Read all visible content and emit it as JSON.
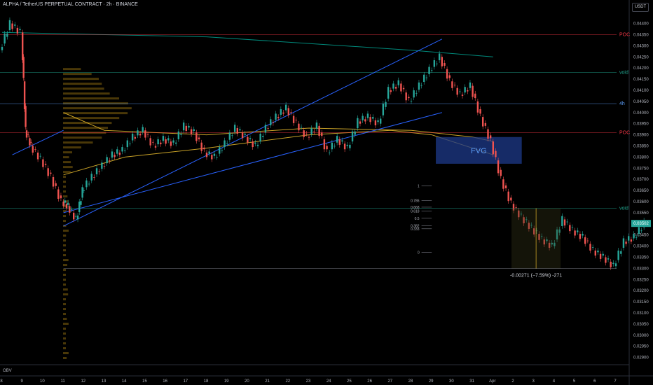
{
  "header": {
    "symbol_title": "ALPHA / TetherUS PERPETUAL CONTRACT · 2h · BINANCE",
    "currency": "USDT"
  },
  "indicator_label": "OBV",
  "chart_data": {
    "type": "candlestick",
    "title": "ALPHA / TetherUS PERPETUAL CONTRACT · 2h · BINANCE",
    "y_ticks": [
      "0.04400",
      "0.04350",
      "0.04300",
      "0.04250",
      "0.04200",
      "0.04150",
      "0.04100",
      "0.04050",
      "0.04000",
      "0.03950",
      "0.03900",
      "0.03850",
      "0.03800",
      "0.03750",
      "0.03700",
      "0.03650",
      "0.03600",
      "0.03550",
      "0.03500",
      "0.03450",
      "0.03400",
      "0.03350",
      "0.03300",
      "0.03250",
      "0.03200",
      "0.03150",
      "0.03100",
      "0.03050",
      "0.03000",
      "0.02950",
      "0.02900"
    ],
    "ylim": [
      0.0288,
      0.0443
    ],
    "x_ticks": [
      "8",
      "9",
      "10",
      "11",
      "12",
      "13",
      "14",
      "15",
      "16",
      "17",
      "18",
      "19",
      "20",
      "21",
      "22",
      "23",
      "24",
      "25",
      "26",
      "27",
      "28",
      "29",
      "30",
      "31",
      "Apr",
      "2",
      "3",
      "4",
      "5",
      "6",
      "7"
    ],
    "current_price": "0.03502",
    "close_path": [
      [
        0,
        0.0428
      ],
      [
        0.5,
        0.044
      ],
      [
        1,
        0.0436
      ],
      [
        1.2,
        0.0392
      ],
      [
        1.5,
        0.0385
      ],
      [
        2,
        0.0379
      ],
      [
        2.5,
        0.0371
      ],
      [
        3,
        0.036
      ],
      [
        3.3,
        0.0358
      ],
      [
        3.7,
        0.0352
      ],
      [
        4,
        0.0365
      ],
      [
        4.5,
        0.0371
      ],
      [
        5,
        0.0376
      ],
      [
        5.5,
        0.0381
      ],
      [
        6,
        0.0383
      ],
      [
        6.5,
        0.0389
      ],
      [
        7,
        0.0392
      ],
      [
        7.5,
        0.0385
      ],
      [
        8,
        0.0388
      ],
      [
        8.5,
        0.0386
      ],
      [
        9,
        0.0394
      ],
      [
        9.5,
        0.0391
      ],
      [
        10,
        0.0382
      ],
      [
        10.5,
        0.038
      ],
      [
        11,
        0.0386
      ],
      [
        11.5,
        0.0393
      ],
      [
        12,
        0.0389
      ],
      [
        12.5,
        0.0385
      ],
      [
        13,
        0.0393
      ],
      [
        13.5,
        0.0398
      ],
      [
        14,
        0.0402
      ],
      [
        14.5,
        0.0395
      ],
      [
        15,
        0.0389
      ],
      [
        15.5,
        0.0394
      ],
      [
        16,
        0.0382
      ],
      [
        16.5,
        0.0388
      ],
      [
        17,
        0.0384
      ],
      [
        17.5,
        0.0396
      ],
      [
        18,
        0.0398
      ],
      [
        18.5,
        0.0395
      ],
      [
        19,
        0.041
      ],
      [
        19.5,
        0.0413
      ],
      [
        20,
        0.0405
      ],
      [
        20.5,
        0.0412
      ],
      [
        21,
        0.0419
      ],
      [
        21.5,
        0.0425
      ],
      [
        22,
        0.0414
      ],
      [
        22.5,
        0.0408
      ],
      [
        23,
        0.0412
      ],
      [
        23.5,
        0.0398
      ],
      [
        24,
        0.0387
      ],
      [
        24.5,
        0.037
      ],
      [
        25,
        0.0359
      ],
      [
        25.5,
        0.0353
      ],
      [
        26,
        0.0348
      ],
      [
        26.5,
        0.0343
      ],
      [
        27,
        0.034
      ],
      [
        27.5,
        0.0352
      ],
      [
        28,
        0.0347
      ],
      [
        28.5,
        0.0344
      ],
      [
        29,
        0.0338
      ],
      [
        29.5,
        0.0335
      ],
      [
        30,
        0.0331
      ],
      [
        30.5,
        0.0342
      ],
      [
        31,
        0.0344
      ],
      [
        31.5,
        0.035
      ]
    ],
    "horizontal_levels": [
      {
        "label": "POC",
        "value": 0.0435,
        "color": "#f23645"
      },
      {
        "label": "void",
        "value": 0.0418,
        "color": "#22ab94"
      },
      {
        "label": "4h",
        "value": 0.0404,
        "color": "#5b9cf6"
      },
      {
        "label": "POC",
        "value": 0.0391,
        "color": "#f23645"
      },
      {
        "label": "void",
        "value": 0.0357,
        "color": "#22ab94"
      }
    ],
    "fvg_label": "FVG",
    "fib_levels": [
      {
        "label": "1",
        "value": 0.0367
      },
      {
        "label": "0.786",
        "value": 0.03605
      },
      {
        "label": "0.668",
        "value": 0.03575
      },
      {
        "label": "0.618",
        "value": 0.03557
      },
      {
        "label": "0.5",
        "value": 0.03525
      },
      {
        "label": "0.382",
        "value": 0.03492
      },
      {
        "label": "0.333",
        "value": 0.03478
      },
      {
        "label": "0",
        "value": 0.03372
      }
    ],
    "measurement": {
      "text": "-0.00271 (−7.59%) -271",
      "from": 0.0357,
      "to": 0.03299
    },
    "colors": {
      "up": "#26a69a",
      "down": "#ef5350",
      "trend": "#2962ff",
      "ma_yellow": "#c9a227",
      "ma_teal": "#00897b",
      "profile": "#d4a017",
      "fvg": "#1e3a8a"
    }
  }
}
